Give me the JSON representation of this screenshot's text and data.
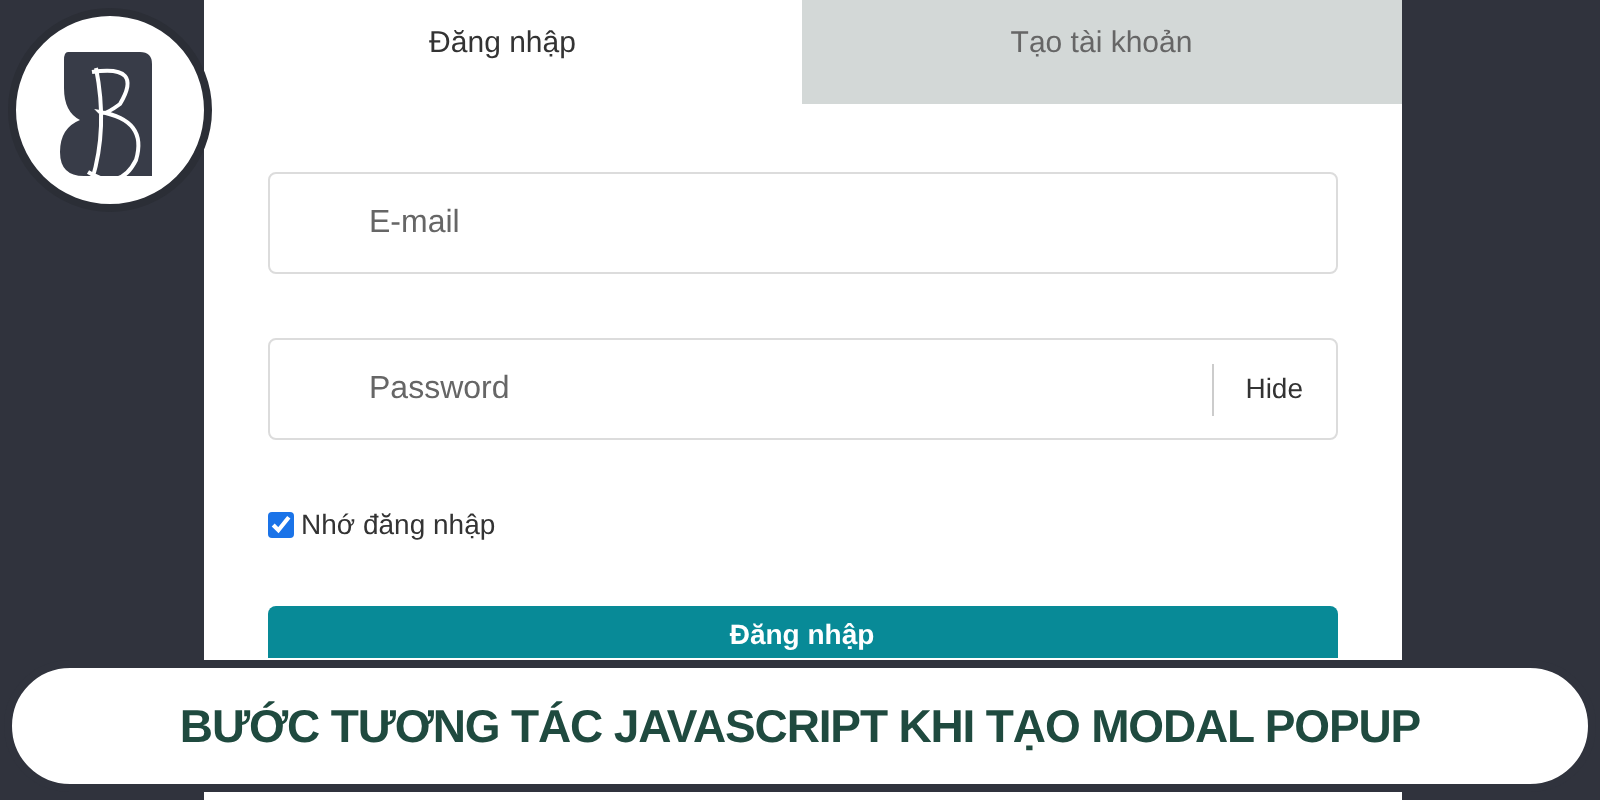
{
  "tabs": [
    {
      "label": "Đăng nhập",
      "selected": true
    },
    {
      "label": "Tạo tài khoản",
      "selected": false
    }
  ],
  "fields": [
    {
      "placeholder": "E-mail"
    },
    {
      "placeholder": "Password",
      "toggle": "Hide"
    }
  ],
  "remember": {
    "label": "Nhớ đăng nhập",
    "checked": true
  },
  "submit_button": "Đăng nhập",
  "banner": {
    "title": "BƯỚC TƯƠNG TÁC JAVASCRIPT KHI TẠO MODAL POPUP"
  }
}
